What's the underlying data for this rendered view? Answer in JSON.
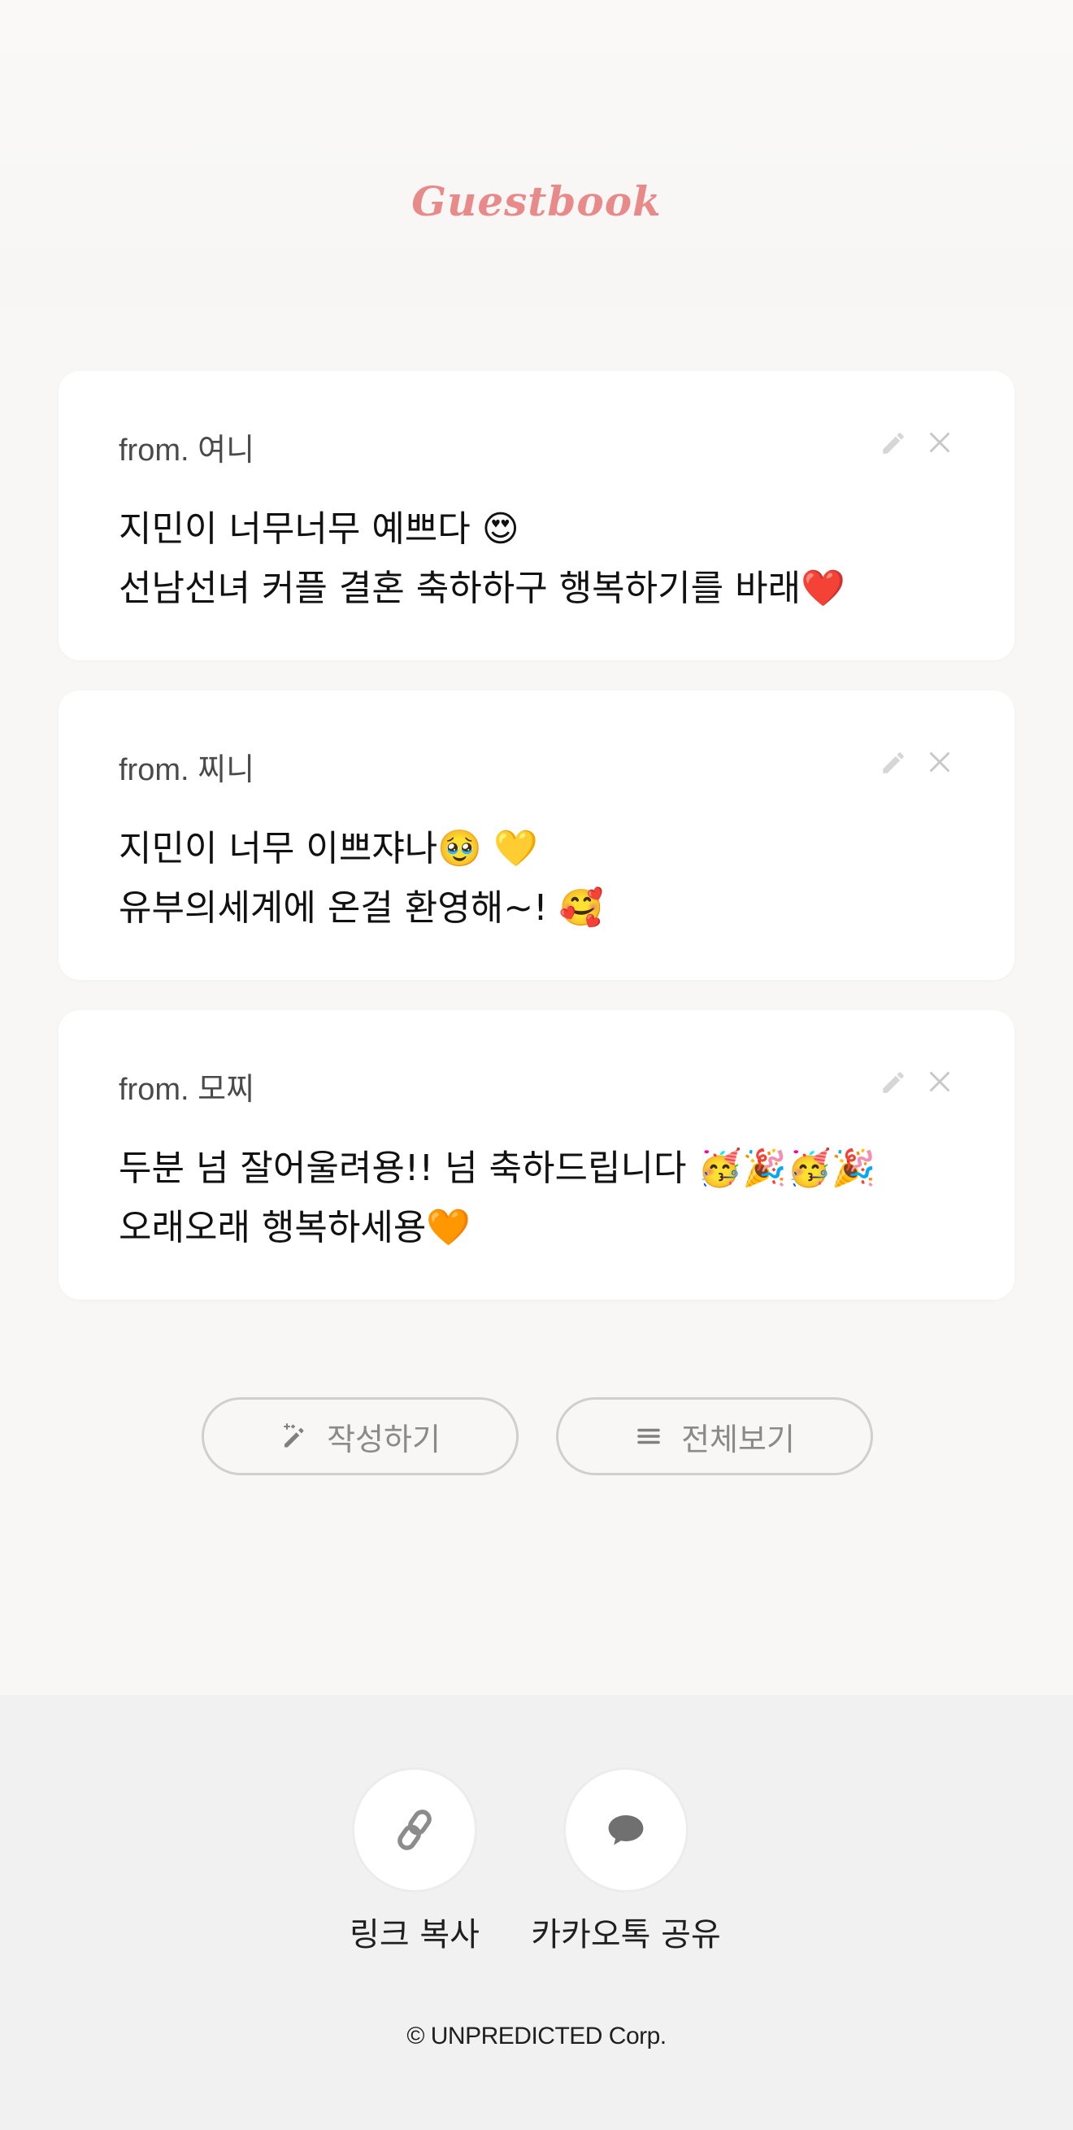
{
  "header": {
    "title": "Guestbook",
    "title_color": "#e88a8a"
  },
  "guestbook": {
    "entries": [
      {
        "from": "from. 여니",
        "lines": [
          "지민이 너무너무 예쁘다 😍",
          "선남선녀 커플 결혼 축하하구 행복하기를 바래❤️"
        ]
      },
      {
        "from": "from. 찌니",
        "lines": [
          "지민이 너무 이쁘쟈나🥹 💛",
          "유부의세계에 온걸 환영해~! 🥰"
        ]
      },
      {
        "from": "from. 모찌",
        "lines": [
          "두분 넘 잘어울려용!! 넘 축하드립니다 🥳🎉🥳🎉",
          "오래오래 행복하세용🧡"
        ]
      }
    ],
    "entry_icons": [
      "pencil-icon",
      "close-icon"
    ]
  },
  "actions": {
    "write_label": "작성하기",
    "write_icon": "magic-pencil-icon",
    "view_all_label": "전체보기",
    "view_all_icon": "menu-lines-icon"
  },
  "share": {
    "copy_link_label": "링크 복사",
    "copy_link_icon": "link-icon",
    "kakao_label": "카카오톡 공유",
    "kakao_icon": "speech-bubble-icon"
  },
  "footer": {
    "copyright": "© UNPREDICTED Corp."
  }
}
